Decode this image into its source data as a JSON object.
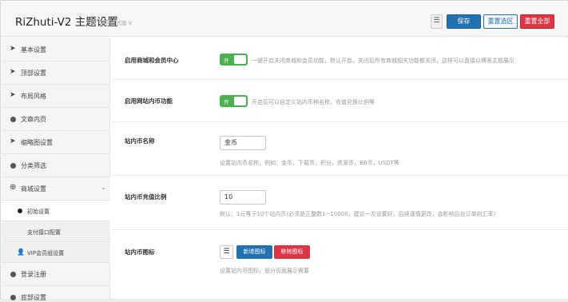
{
  "header": {
    "title": "RiZhuti-V2 主题设置",
    "version": "会员正式版 V",
    "menu_icon": "list-icon",
    "save_label": "保存",
    "reset_selection_label": "重置选区",
    "reset_all_label": "重置全部"
  },
  "sidebar": {
    "items": [
      {
        "label": "基本设置",
        "icon": "paper-plane-icon"
      },
      {
        "label": "顶部设置",
        "icon": "paper-plane-icon"
      },
      {
        "label": "布局风格",
        "icon": "paper-plane-icon"
      },
      {
        "label": "文章内页",
        "icon": "circle-icon"
      },
      {
        "label": "缩略图设置",
        "icon": "paper-plane-icon"
      },
      {
        "label": "分类筛选",
        "icon": "circle-icon"
      },
      {
        "label": "商城设置",
        "icon": "plus-circle-icon"
      },
      {
        "label": "登录注册",
        "icon": "circle-icon"
      },
      {
        "label": "底部设置",
        "icon": "circle-icon"
      }
    ],
    "subitems": [
      {
        "label": "初始设置",
        "active": true
      },
      {
        "label": "支付接口配置",
        "active": false
      },
      {
        "label": "VIP会员组设置",
        "active": false
      }
    ]
  },
  "main": {
    "rows": [
      {
        "label": "启用商城和会员中心",
        "toggle_label": "开",
        "toggle_on": true,
        "desc": "一键开启关闭商城和会员功能，默认开启，关闭后所有商城相关功能都关闭，这样可以直接以博客主题展示"
      },
      {
        "label": "启用网站内币功能",
        "toggle_label": "开",
        "toggle_on": true,
        "desc": "开启后可以自定义站内币种名称，充值兑换比例等"
      },
      {
        "label": "站内币名称",
        "value": "金币",
        "desc": "设置站内币名称，例如：金币，下载币，积分，资源币，BB币，USDT等"
      },
      {
        "label": "站内币充值比例",
        "value": "10",
        "desc": "默认：1元等于10个站内币(必须是正整数1~10000，建议一次设置好，后续谨慎更改，会影响后台订单的汇率)"
      },
      {
        "label": "站内币图标",
        "add_label": "新增图标",
        "remove_label": "移除图标",
        "desc": "设置站内币图标，部分页面展示需要"
      }
    ]
  },
  "colors": {
    "primary": "#2271b1",
    "danger": "#dc3545",
    "toggle_on": "#4caf50"
  }
}
